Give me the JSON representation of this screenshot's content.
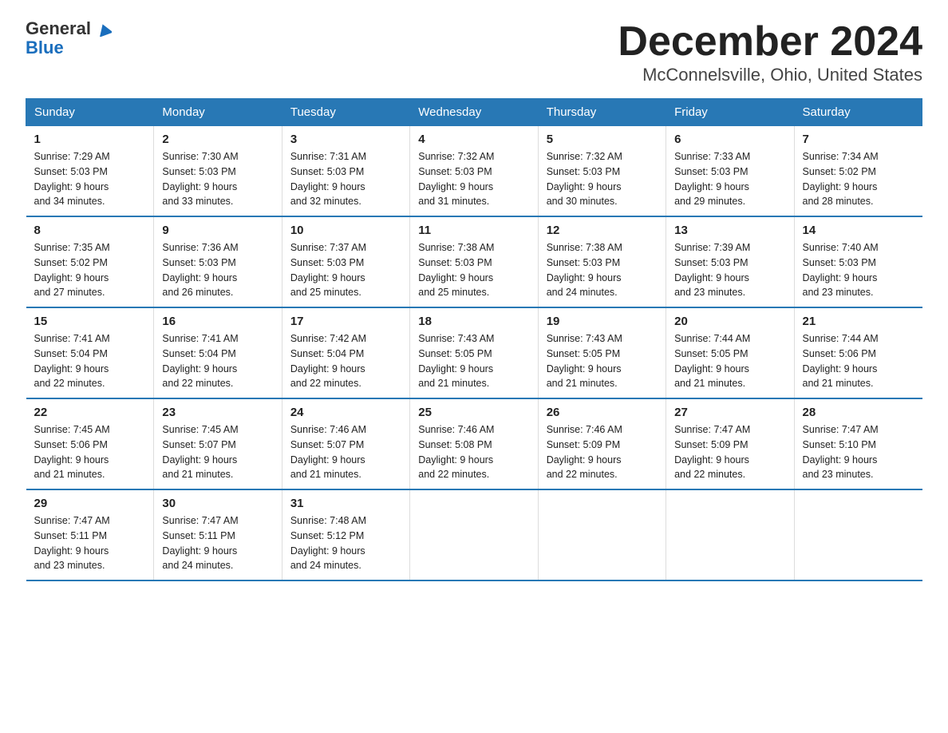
{
  "logo": {
    "line1": "General",
    "line2": "Blue"
  },
  "title": "December 2024",
  "subtitle": "McConnelsville, Ohio, United States",
  "days_of_week": [
    "Sunday",
    "Monday",
    "Tuesday",
    "Wednesday",
    "Thursday",
    "Friday",
    "Saturday"
  ],
  "weeks": [
    [
      {
        "day": "1",
        "info": "Sunrise: 7:29 AM\nSunset: 5:03 PM\nDaylight: 9 hours\nand 34 minutes."
      },
      {
        "day": "2",
        "info": "Sunrise: 7:30 AM\nSunset: 5:03 PM\nDaylight: 9 hours\nand 33 minutes."
      },
      {
        "day": "3",
        "info": "Sunrise: 7:31 AM\nSunset: 5:03 PM\nDaylight: 9 hours\nand 32 minutes."
      },
      {
        "day": "4",
        "info": "Sunrise: 7:32 AM\nSunset: 5:03 PM\nDaylight: 9 hours\nand 31 minutes."
      },
      {
        "day": "5",
        "info": "Sunrise: 7:32 AM\nSunset: 5:03 PM\nDaylight: 9 hours\nand 30 minutes."
      },
      {
        "day": "6",
        "info": "Sunrise: 7:33 AM\nSunset: 5:03 PM\nDaylight: 9 hours\nand 29 minutes."
      },
      {
        "day": "7",
        "info": "Sunrise: 7:34 AM\nSunset: 5:02 PM\nDaylight: 9 hours\nand 28 minutes."
      }
    ],
    [
      {
        "day": "8",
        "info": "Sunrise: 7:35 AM\nSunset: 5:02 PM\nDaylight: 9 hours\nand 27 minutes."
      },
      {
        "day": "9",
        "info": "Sunrise: 7:36 AM\nSunset: 5:03 PM\nDaylight: 9 hours\nand 26 minutes."
      },
      {
        "day": "10",
        "info": "Sunrise: 7:37 AM\nSunset: 5:03 PM\nDaylight: 9 hours\nand 25 minutes."
      },
      {
        "day": "11",
        "info": "Sunrise: 7:38 AM\nSunset: 5:03 PM\nDaylight: 9 hours\nand 25 minutes."
      },
      {
        "day": "12",
        "info": "Sunrise: 7:38 AM\nSunset: 5:03 PM\nDaylight: 9 hours\nand 24 minutes."
      },
      {
        "day": "13",
        "info": "Sunrise: 7:39 AM\nSunset: 5:03 PM\nDaylight: 9 hours\nand 23 minutes."
      },
      {
        "day": "14",
        "info": "Sunrise: 7:40 AM\nSunset: 5:03 PM\nDaylight: 9 hours\nand 23 minutes."
      }
    ],
    [
      {
        "day": "15",
        "info": "Sunrise: 7:41 AM\nSunset: 5:04 PM\nDaylight: 9 hours\nand 22 minutes."
      },
      {
        "day": "16",
        "info": "Sunrise: 7:41 AM\nSunset: 5:04 PM\nDaylight: 9 hours\nand 22 minutes."
      },
      {
        "day": "17",
        "info": "Sunrise: 7:42 AM\nSunset: 5:04 PM\nDaylight: 9 hours\nand 22 minutes."
      },
      {
        "day": "18",
        "info": "Sunrise: 7:43 AM\nSunset: 5:05 PM\nDaylight: 9 hours\nand 21 minutes."
      },
      {
        "day": "19",
        "info": "Sunrise: 7:43 AM\nSunset: 5:05 PM\nDaylight: 9 hours\nand 21 minutes."
      },
      {
        "day": "20",
        "info": "Sunrise: 7:44 AM\nSunset: 5:05 PM\nDaylight: 9 hours\nand 21 minutes."
      },
      {
        "day": "21",
        "info": "Sunrise: 7:44 AM\nSunset: 5:06 PM\nDaylight: 9 hours\nand 21 minutes."
      }
    ],
    [
      {
        "day": "22",
        "info": "Sunrise: 7:45 AM\nSunset: 5:06 PM\nDaylight: 9 hours\nand 21 minutes."
      },
      {
        "day": "23",
        "info": "Sunrise: 7:45 AM\nSunset: 5:07 PM\nDaylight: 9 hours\nand 21 minutes."
      },
      {
        "day": "24",
        "info": "Sunrise: 7:46 AM\nSunset: 5:07 PM\nDaylight: 9 hours\nand 21 minutes."
      },
      {
        "day": "25",
        "info": "Sunrise: 7:46 AM\nSunset: 5:08 PM\nDaylight: 9 hours\nand 22 minutes."
      },
      {
        "day": "26",
        "info": "Sunrise: 7:46 AM\nSunset: 5:09 PM\nDaylight: 9 hours\nand 22 minutes."
      },
      {
        "day": "27",
        "info": "Sunrise: 7:47 AM\nSunset: 5:09 PM\nDaylight: 9 hours\nand 22 minutes."
      },
      {
        "day": "28",
        "info": "Sunrise: 7:47 AM\nSunset: 5:10 PM\nDaylight: 9 hours\nand 23 minutes."
      }
    ],
    [
      {
        "day": "29",
        "info": "Sunrise: 7:47 AM\nSunset: 5:11 PM\nDaylight: 9 hours\nand 23 minutes."
      },
      {
        "day": "30",
        "info": "Sunrise: 7:47 AM\nSunset: 5:11 PM\nDaylight: 9 hours\nand 24 minutes."
      },
      {
        "day": "31",
        "info": "Sunrise: 7:48 AM\nSunset: 5:12 PM\nDaylight: 9 hours\nand 24 minutes."
      },
      {
        "day": "",
        "info": ""
      },
      {
        "day": "",
        "info": ""
      },
      {
        "day": "",
        "info": ""
      },
      {
        "day": "",
        "info": ""
      }
    ]
  ]
}
